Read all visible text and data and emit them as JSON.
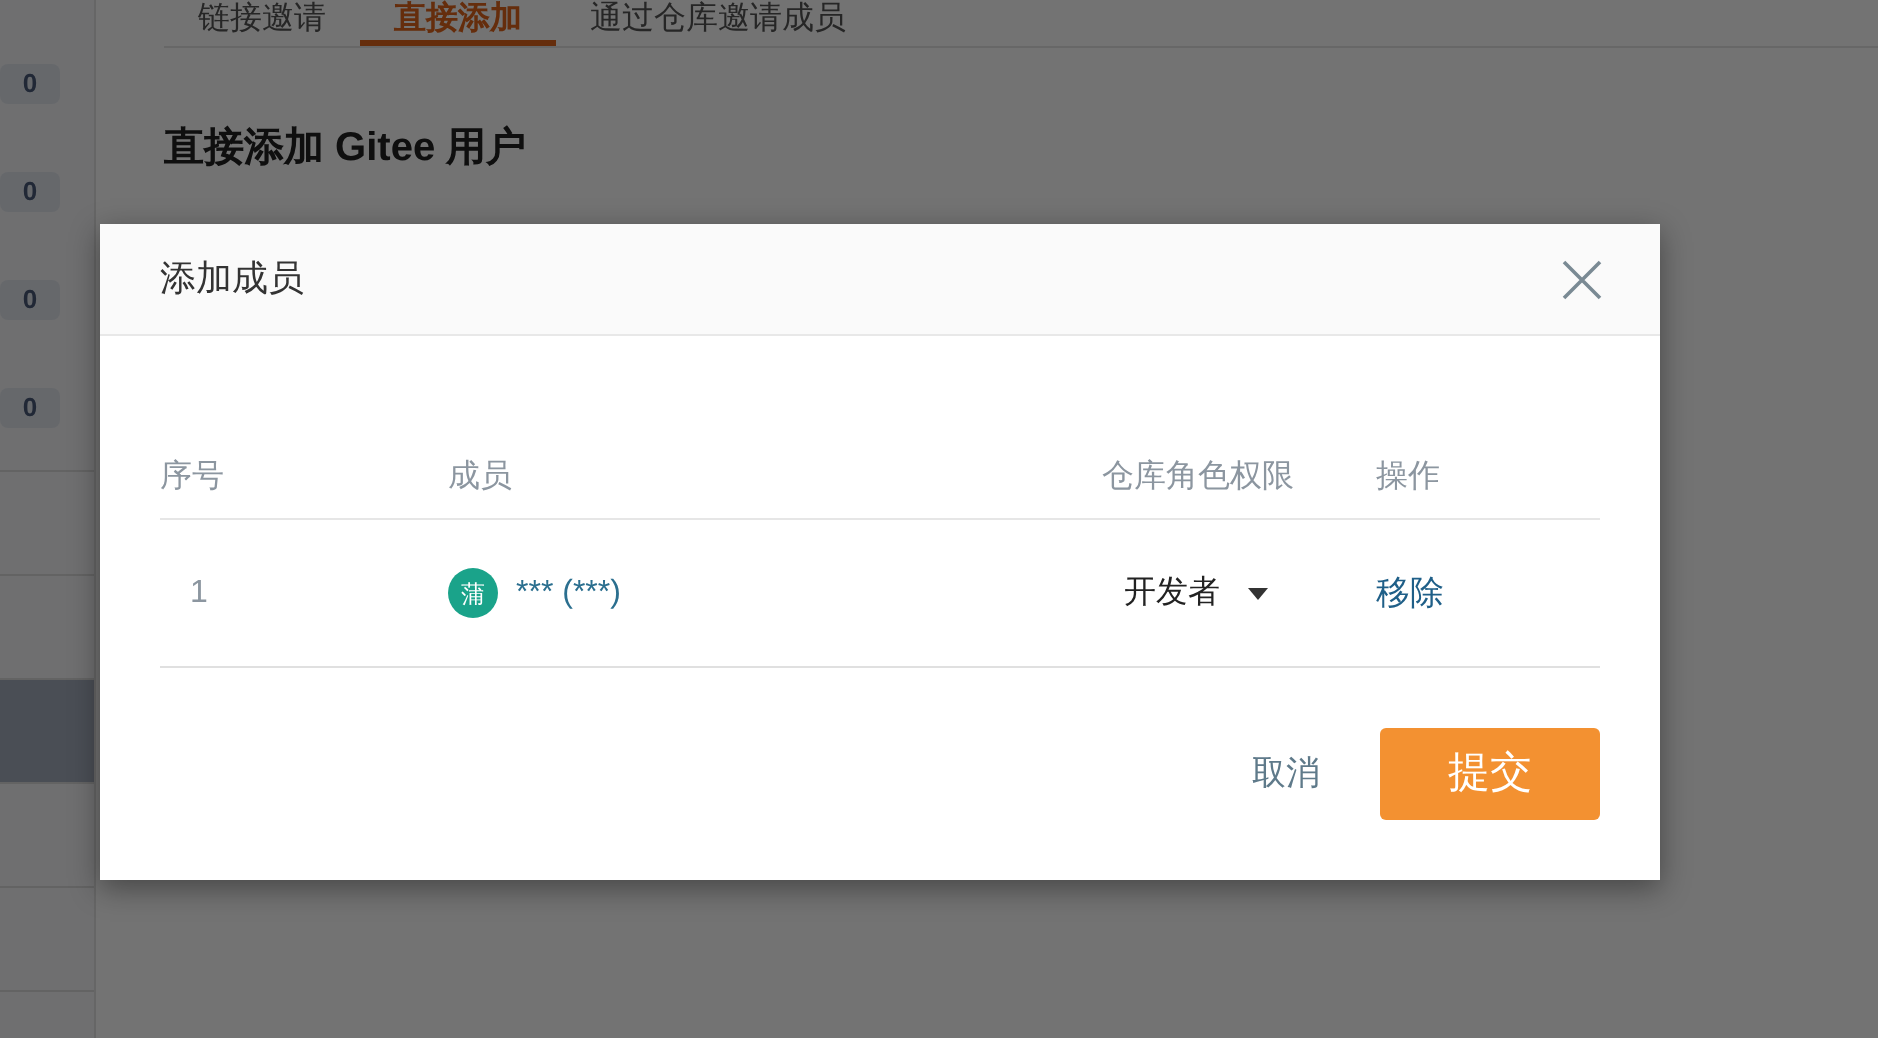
{
  "sidebar": {
    "badges": [
      "0",
      "0",
      "0",
      "0"
    ],
    "items": [
      {
        "selected": false
      },
      {
        "selected": false
      },
      {
        "selected": true
      },
      {
        "selected": false
      },
      {
        "selected": false
      },
      {
        "selected": false
      }
    ]
  },
  "tabs": [
    {
      "label": "链接邀请",
      "selected": false
    },
    {
      "label": "直接添加",
      "selected": true
    },
    {
      "label": "通过仓库邀请成员",
      "selected": false
    }
  ],
  "heading": "直接添加 Gitee 用户",
  "dialog": {
    "title": "添加成员",
    "table": {
      "columns": [
        "序号",
        "成员",
        "仓库角色权限",
        "操作"
      ],
      "rows": [
        {
          "index": "1",
          "avatar": "蒲",
          "member": "*** (***)",
          "role": "开发者",
          "action": "移除"
        }
      ]
    },
    "buttons": [
      {
        "label": "取消",
        "kind": "text"
      },
      {
        "label": "提交",
        "kind": "primary"
      }
    ]
  }
}
